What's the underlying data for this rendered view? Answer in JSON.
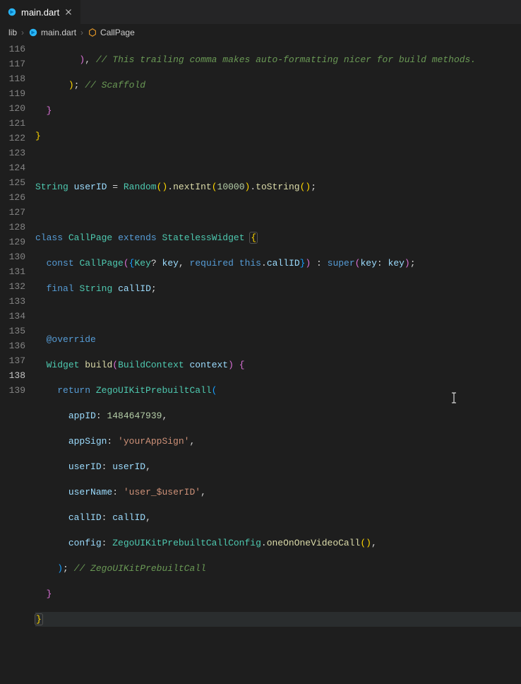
{
  "tab": {
    "filename": "main.dart",
    "close_glyph": "×"
  },
  "breadcrumbs": {
    "items": [
      "lib",
      "main.dart",
      "CallPage"
    ]
  },
  "gutter": {
    "start": 116,
    "end": 139,
    "active": 138
  },
  "code": {
    "l116": {
      "br1": ")",
      "comma": ",",
      "comment": "// This trailing comma makes auto-formatting nicer for build methods."
    },
    "l117": {
      "br1": ")",
      "semi": ";",
      "comment": "// Scaffold"
    },
    "l118": {
      "br": "}"
    },
    "l119": {
      "br": "}"
    },
    "l121": {
      "kw1": "String",
      "var1": "userID",
      "eq": " = ",
      "type1": "Random",
      "p1": "(",
      "p2": ")",
      "dot1": ".",
      "fn1": "nextInt",
      "p3": "(",
      "num": "10000",
      "p4": ")",
      "dot2": ".",
      "fn2": "toString",
      "p5": "(",
      "p6": ")",
      "semi": ";"
    },
    "l123": {
      "kw1": "class",
      "type1": "CallPage",
      "kw2": "extends",
      "type2": "StatelessWidget",
      "br": "{"
    },
    "l124": {
      "kw1": "const",
      "type1": "CallPage",
      "p1": "(",
      "br1": "{",
      "type2": "Key",
      "q": "?",
      "var1": "key",
      "c1": ",",
      "kw2": "required",
      "kw3": "this",
      "dot": ".",
      "var2": "callID",
      "br2": "}",
      "p2": ")",
      "colon": " : ",
      "kw4": "super",
      "p3": "(",
      "var3": "key",
      "c2": ":",
      "var4": "key",
      "p4": ")",
      "semi": ";"
    },
    "l125": {
      "kw1": "final",
      "kw2": "String",
      "var1": "callID",
      "semi": ";"
    },
    "l127": {
      "annot": "@override"
    },
    "l128": {
      "type1": "Widget",
      "fn1": "build",
      "p1": "(",
      "type2": "BuildContext",
      "var1": "context",
      "p2": ")",
      "br": "{"
    },
    "l129": {
      "kw1": "return",
      "type1": "ZegoUIKitPrebuiltCall",
      "p1": "("
    },
    "l130": {
      "var1": "appID",
      "c": ":",
      "num": "1484647939",
      "comma": ","
    },
    "l131": {
      "var1": "appSign",
      "c": ":",
      "str": "'yourAppSign'",
      "comma": ","
    },
    "l132": {
      "var1": "userID",
      "c": ":",
      "var2": "userID",
      "comma": ","
    },
    "l133": {
      "var1": "userName",
      "c": ":",
      "str": "'user_$userID'",
      "comma": ","
    },
    "l134": {
      "var1": "callID",
      "c": ":",
      "var2": "callID",
      "comma": ","
    },
    "l135": {
      "var1": "config",
      "c": ":",
      "type1": "ZegoUIKitPrebuiltCallConfig",
      "dot": ".",
      "fn1": "oneOnOneVideoCall",
      "p1": "(",
      "p2": ")",
      "comma": ","
    },
    "l136": {
      "p1": ")",
      "semi": ";",
      "comment": "// ZegoUIKitPrebuiltCall"
    },
    "l137": {
      "br": "}"
    },
    "l138": {
      "br": "}"
    }
  }
}
